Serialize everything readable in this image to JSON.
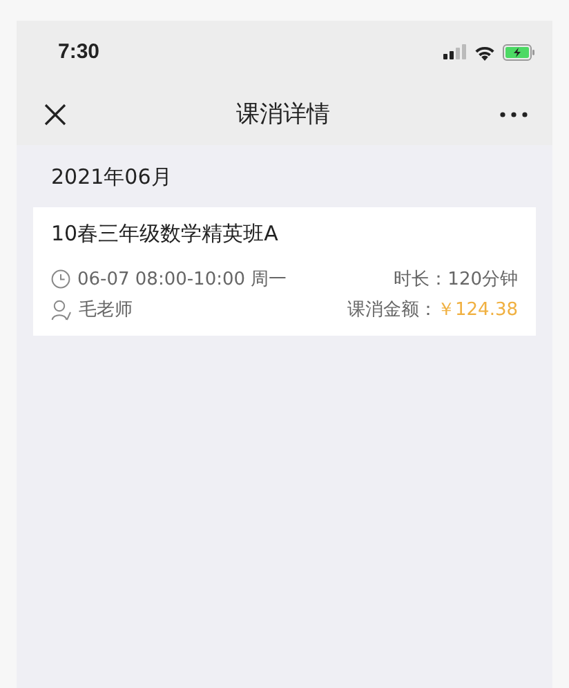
{
  "status_bar": {
    "time": "7:30"
  },
  "nav_bar": {
    "title": "课消详情"
  },
  "month": "2021年06月",
  "records": [
    {
      "course": "10春三年级数学精英班A",
      "schedule": "06-07 08:00-10:00 周一",
      "duration_label": "时长：",
      "duration": "120分钟",
      "teacher": "毛老师",
      "amount_label": "课消金额：",
      "amount": "￥124.38"
    }
  ]
}
